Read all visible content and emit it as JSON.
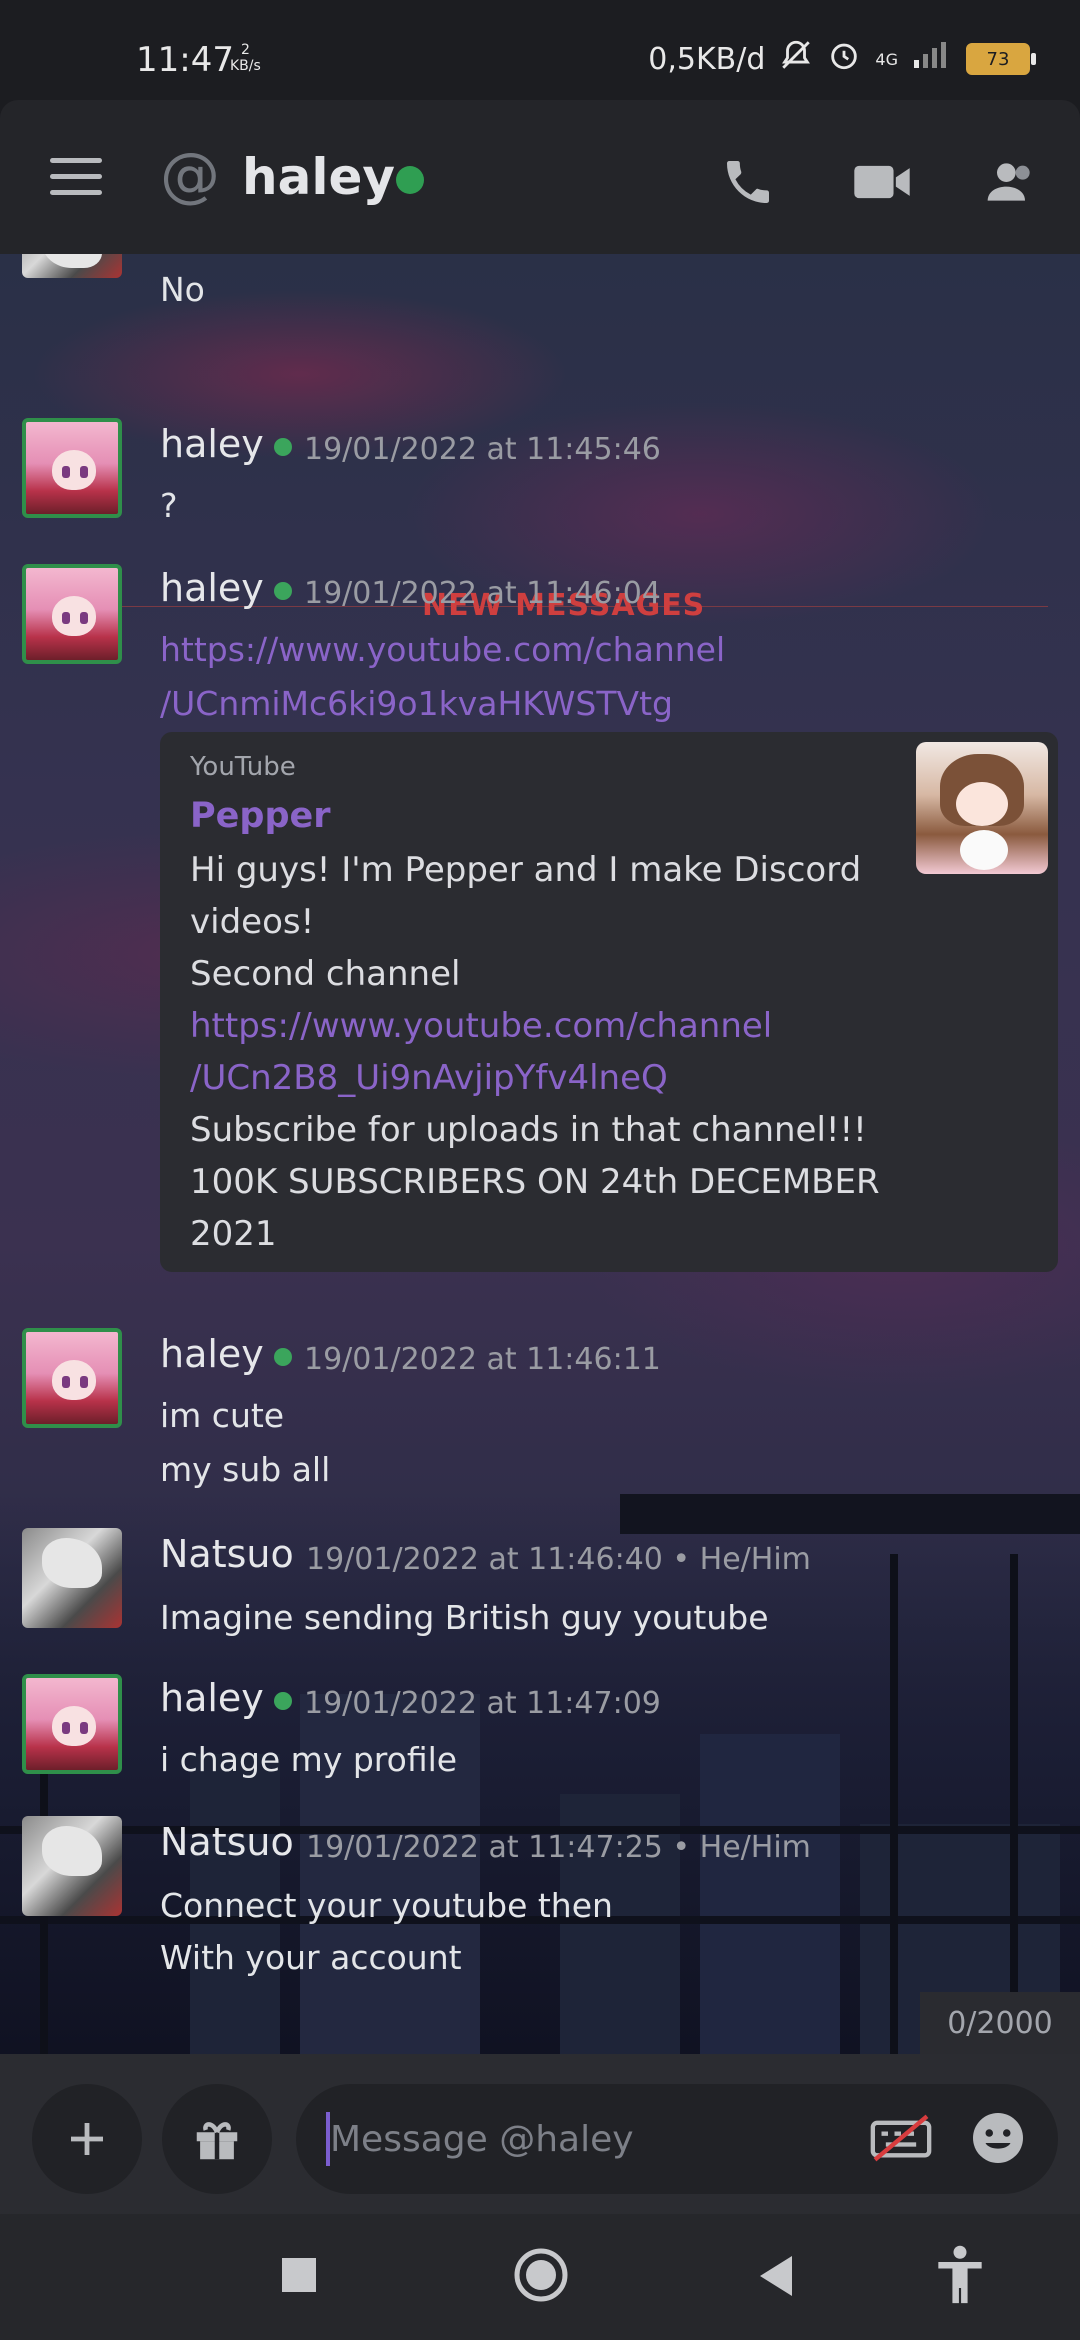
{
  "status_bar": {
    "time": "11:47",
    "speed_value": "2",
    "speed_unit": "KB/s",
    "data_rate": "0,5KB/d",
    "network": "4G",
    "battery": "73"
  },
  "header": {
    "title": "haley",
    "at_symbol": "@",
    "icons": [
      "menu-icon",
      "phone-icon",
      "video-icon",
      "members-icon"
    ]
  },
  "chat": {
    "prev_message": "No",
    "divider_label": "NEW MESSAGES",
    "messages": [
      {
        "author": "haley",
        "timestamp": "19/01/2022 at 11:45:46",
        "lines": [
          "?"
        ]
      },
      {
        "author": "haley",
        "timestamp": "19/01/2022 at 11:46:04",
        "link_lines": [
          "https://www.youtube.com/channel",
          "/UCnmiMc6ki9o1kvaHKWSTVtg"
        ]
      },
      {
        "author": "haley",
        "timestamp": "19/01/2022 at 11:46:11",
        "lines": [
          "im cute",
          "my sub all"
        ]
      },
      {
        "author": "Natsuo",
        "timestamp": "19/01/2022 at 11:46:40 • He/Him",
        "lines": [
          "Imagine sending British guy youtube"
        ]
      },
      {
        "author": "haley",
        "timestamp": "19/01/2022 at 11:47:09",
        "lines": [
          "i chage my profile"
        ]
      },
      {
        "author": "Natsuo",
        "timestamp": "19/01/2022 at 11:47:25 • He/Him",
        "lines": [
          "Connect your youtube then",
          "With your account"
        ]
      }
    ],
    "embed": {
      "provider": "YouTube",
      "title": "Pepper",
      "line1": "Hi guys! I'm Pepper and I make Discord",
      "line2": "videos!",
      "line3": "Second channel",
      "link1": "https://www.youtube.com/channel",
      "link2": "/UCn2B8_Ui9nAvjipYfv4lneQ",
      "line4": "Subscribe for uploads in that channel!!!",
      "line5": "100K SUBSCRIBERS ON 24th DECEMBER",
      "line6": "2021"
    }
  },
  "composer": {
    "char_counter": "0/2000",
    "placeholder": "Message @haley",
    "value": ""
  },
  "colors": {
    "accent_link": "#8a64c8",
    "online_green": "#3ba55c",
    "new_messages_red": "#cf3f3f",
    "battery": "#d9a640"
  }
}
